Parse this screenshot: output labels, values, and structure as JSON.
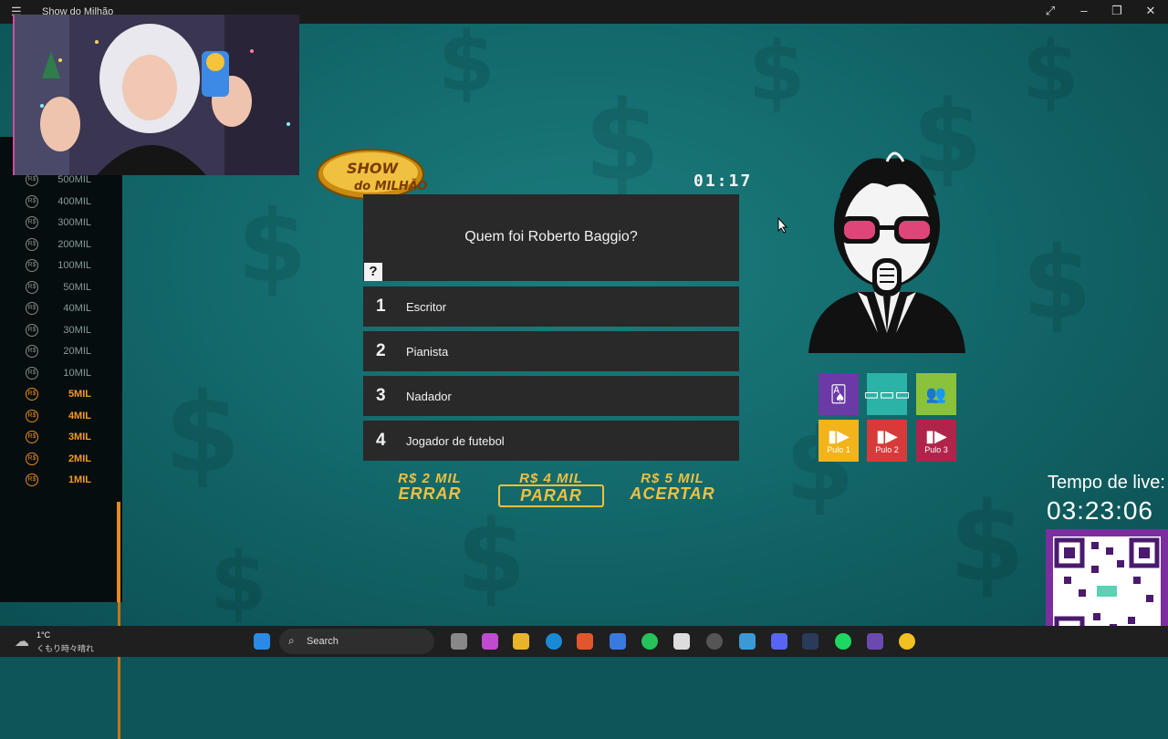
{
  "window": {
    "title": "Show do Milhão"
  },
  "logo": {
    "line1": "SHOW",
    "line2": "do MILHÃO"
  },
  "timer": "01:17",
  "question": {
    "text": "Quem foi Roberto Baggio?",
    "mark": "?"
  },
  "answers": [
    {
      "num": "1",
      "label": "Escritor"
    },
    {
      "num": "2",
      "label": "Pianista"
    },
    {
      "num": "3",
      "label": "Nadador"
    },
    {
      "num": "4",
      "label": "Jogador de futebol"
    }
  ],
  "prize_options": [
    {
      "value": "R$ 2 MIL",
      "word": "ERRAR"
    },
    {
      "value": "R$ 4 MIL",
      "word": "PARAR"
    },
    {
      "value": "R$ 5 MIL",
      "word": "ACERTAR"
    }
  ],
  "ladder": [
    {
      "amount": "500MIL",
      "current": false
    },
    {
      "amount": "400MIL",
      "current": false
    },
    {
      "amount": "300MIL",
      "current": false
    },
    {
      "amount": "200MIL",
      "current": false
    },
    {
      "amount": "100MIL",
      "current": false
    },
    {
      "amount": "50MIL",
      "current": false
    },
    {
      "amount": "40MIL",
      "current": false
    },
    {
      "amount": "30MIL",
      "current": false
    },
    {
      "amount": "20MIL",
      "current": false
    },
    {
      "amount": "10MIL",
      "current": false
    },
    {
      "amount": "5MIL",
      "current": true
    },
    {
      "amount": "4MIL",
      "current": true
    },
    {
      "amount": "3MIL",
      "current": true
    },
    {
      "amount": "2MIL",
      "current": true
    },
    {
      "amount": "1MIL",
      "current": true
    }
  ],
  "coin_symbol": "R$",
  "lifelines": {
    "cards_icon": "cards-icon",
    "placards_icon": "placards-icon",
    "audience_icon": "audience-icon",
    "skip1": "Pulo 1",
    "skip2": "Pulo 2",
    "skip3": "Pulo 3"
  },
  "live": {
    "label": "Tempo de live:",
    "time": "03:23:06"
  },
  "taskbar": {
    "temperature": "1°C",
    "condition": "くもり時々晴れ",
    "search_label": "Search"
  },
  "colors": {
    "gold": "#f0c040",
    "ladder_accent": "#e88a1a",
    "teal": "#13696b"
  }
}
